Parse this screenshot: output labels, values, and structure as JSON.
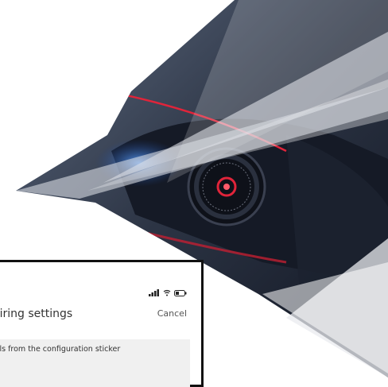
{
  "screen": {
    "title": "airing settings",
    "cancel_label": "Cancel",
    "info_text": "ails from the configuration sticker"
  },
  "status_bar": {
    "icons": [
      "signal-icon",
      "wifi-icon",
      "battery-icon"
    ]
  },
  "colors": {
    "accent_red": "#e0243a",
    "dark_bg": "#1a2130",
    "blue_glow": "#2f6fd8",
    "panel_bg": "#f0f0f0",
    "frame": "#111111"
  }
}
